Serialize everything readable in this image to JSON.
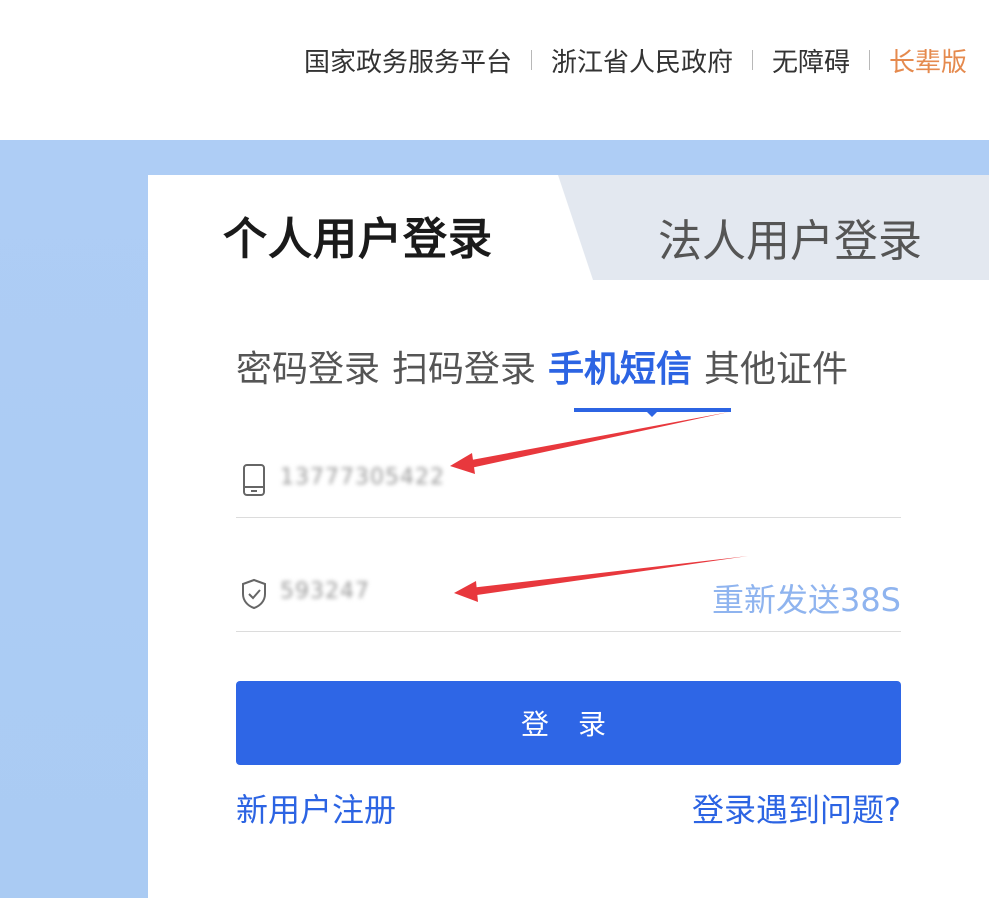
{
  "topnav": {
    "links": [
      "国家政务服务平台",
      "浙江省人民政府",
      "无障碍",
      "长辈版"
    ]
  },
  "login_tabs": {
    "personal": "个人用户登录",
    "legal": "法人用户登录"
  },
  "methods": [
    "密码登录",
    "扫码登录",
    "手机短信",
    "其他证件"
  ],
  "form": {
    "phone_value": "13777305422",
    "code_value": "593247",
    "resend_label": "重新发送38S",
    "login_label": "登 录"
  },
  "footer_links": {
    "register": "新用户注册",
    "help": "登录遇到问题?"
  },
  "colors": {
    "primary": "#2e66e6",
    "accent": "#e58a4e",
    "band": "#aecdf5",
    "arrow": "#e8383d"
  },
  "icons": {
    "phone_field": "mobile-phone-icon",
    "code_field": "shield-check-icon"
  }
}
